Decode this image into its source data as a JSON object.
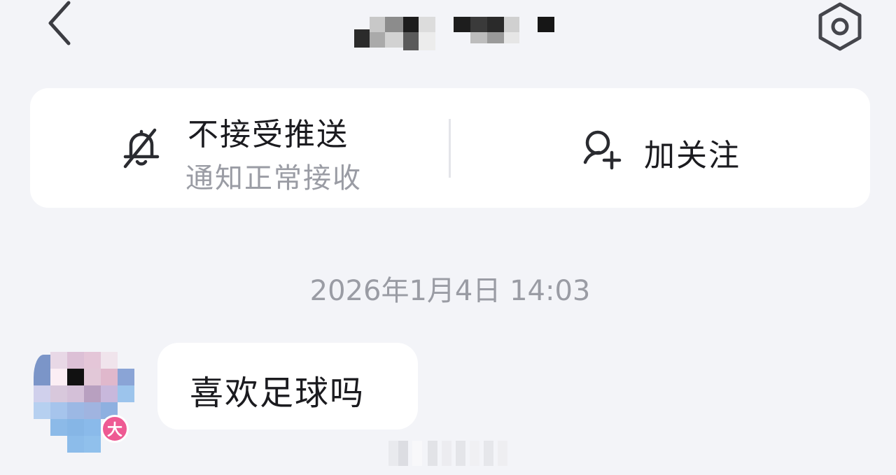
{
  "header": {
    "back_icon": "chevron-left-icon",
    "title": "",
    "settings_icon": "hexagon-settings-icon"
  },
  "actions": {
    "push": {
      "icon": "bell-off-icon",
      "title": "不接受推送",
      "subtitle": "通知正常接收"
    },
    "follow": {
      "icon": "add-user-icon",
      "label": "加关注"
    }
  },
  "conversation": {
    "timestamp": "2026年1月4日 14:03",
    "messages": [
      {
        "sender": "other",
        "level_badge": "大",
        "text": "喜欢足球吗"
      }
    ]
  },
  "colors": {
    "background": "#f3f4f8",
    "card": "#ffffff",
    "text_primary": "#1b1b1f",
    "text_secondary": "#9a9ca4",
    "badge": "#ee5a93"
  }
}
